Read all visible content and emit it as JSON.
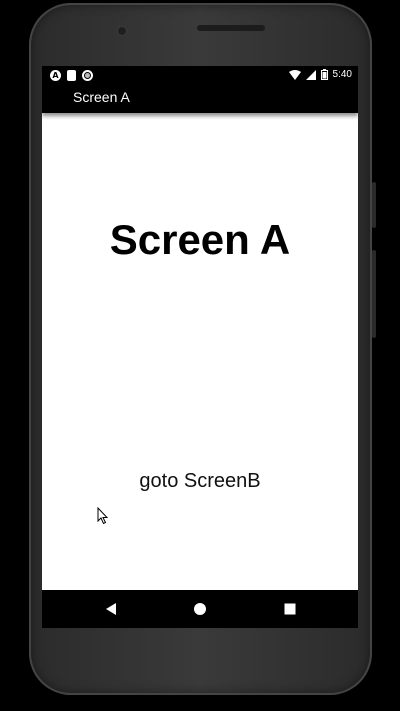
{
  "status_bar": {
    "time": "5:40",
    "left_icons": [
      "a-icon",
      "sd-card-icon",
      "sync-circle-icon"
    ],
    "right_icons": [
      "wifi-icon",
      "cell-signal-icon",
      "battery-icon"
    ]
  },
  "app_bar": {
    "title": "Screen A"
  },
  "main": {
    "heading": "Screen A",
    "goto_button_label": "goto ScreenB"
  },
  "nav_bar": {
    "buttons": [
      "back-icon",
      "home-icon",
      "recents-icon"
    ]
  },
  "colors": {
    "bars": "#000000",
    "screen_bg": "#ffffff",
    "text": "#000000"
  }
}
